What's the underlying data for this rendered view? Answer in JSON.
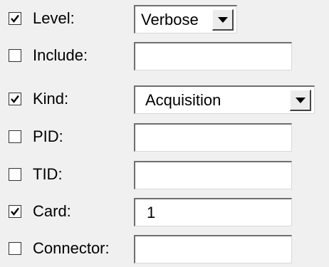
{
  "filters": [
    {
      "label": "Level:",
      "checked": true,
      "kind": "select",
      "value": "Verbose"
    },
    {
      "label": "Include:",
      "checked": false,
      "kind": "text",
      "value": ""
    },
    {
      "label": "Kind:",
      "checked": true,
      "kind": "select",
      "value": "Acquisition"
    },
    {
      "label": "PID:",
      "checked": false,
      "kind": "text",
      "value": ""
    },
    {
      "label": "TID:",
      "checked": false,
      "kind": "text",
      "value": ""
    },
    {
      "label": "Card:",
      "checked": true,
      "kind": "text",
      "value": "1"
    },
    {
      "label": "Connector:",
      "checked": false,
      "kind": "text",
      "value": ""
    }
  ],
  "icons": {
    "checkmark": "checkmark-icon",
    "dropdown": "chevron-down-icon"
  }
}
